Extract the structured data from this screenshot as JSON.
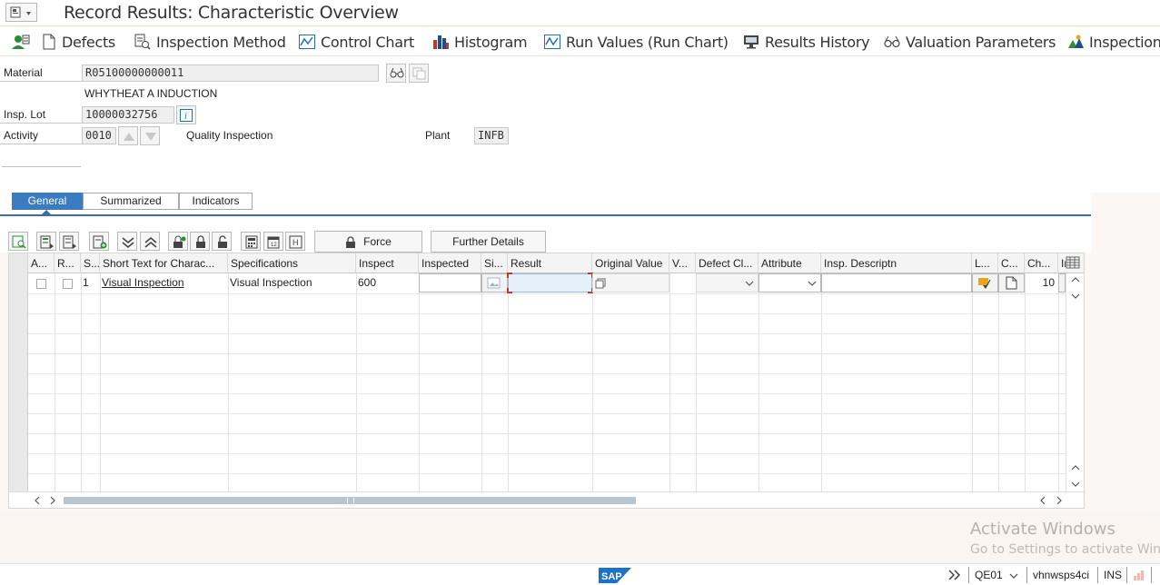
{
  "window": {
    "title": "Record Results: Characteristic Overview"
  },
  "toolbar": {
    "items": [
      {
        "label": "",
        "icon": "person-settings-icon"
      },
      {
        "label": "Defects",
        "icon": "document-icon"
      },
      {
        "label": "Inspection Method",
        "icon": "method-icon"
      },
      {
        "label": "Control Chart",
        "icon": "control-chart-icon"
      },
      {
        "label": "Histogram",
        "icon": "histogram-icon"
      },
      {
        "label": "Run Values (Run Chart)",
        "icon": "run-chart-icon"
      },
      {
        "label": "Results History",
        "icon": "monitor-icon"
      },
      {
        "label": "Valuation Parameters",
        "icon": "glasses-icon"
      },
      {
        "label": "Inspection",
        "icon": "inspection-icon"
      }
    ]
  },
  "header": {
    "material_label": "Material",
    "material_value": "R05100000000011",
    "material_desc": "WHYTHEAT A INDUCTION",
    "lot_label": "Insp. Lot",
    "lot_value": "10000032756",
    "activity_label": "Activity",
    "activity_value": "0010",
    "activity_desc": "Quality Inspection",
    "plant_label": "Plant",
    "plant_value": "INFB"
  },
  "tabs": [
    {
      "label": "General",
      "active": true
    },
    {
      "label": "Summarized",
      "active": false
    },
    {
      "label": "Indicators",
      "active": false
    }
  ],
  "table_toolbar": {
    "force_label": "Force",
    "further_label": "Further Details"
  },
  "table": {
    "columns": [
      "A...",
      "R...",
      "S...",
      "Short Text for Charac...",
      "Specifications",
      "Inspect",
      "Inspected",
      "Si...",
      "Result",
      "Original Value",
      "V...",
      "Defect Cl...",
      "Attribute",
      "Insp. Descriptn",
      "L...",
      "C...",
      "Ch...",
      "Ir"
    ],
    "rows": [
      {
        "seq": "1",
        "short_text": "Visual Inspection",
        "specifications": "Visual Inspection",
        "inspect": "600",
        "chars": "10"
      }
    ]
  },
  "status_bar": {
    "transaction": "QE01",
    "server": "vhnwsps4ci",
    "mode": "INS"
  },
  "watermark": {
    "line1": "Activate Windows",
    "line2": "Go to Settings to activate Windows."
  },
  "colors": {
    "accent": "#3b7bbf",
    "tab_underline": "#3d6e99"
  }
}
